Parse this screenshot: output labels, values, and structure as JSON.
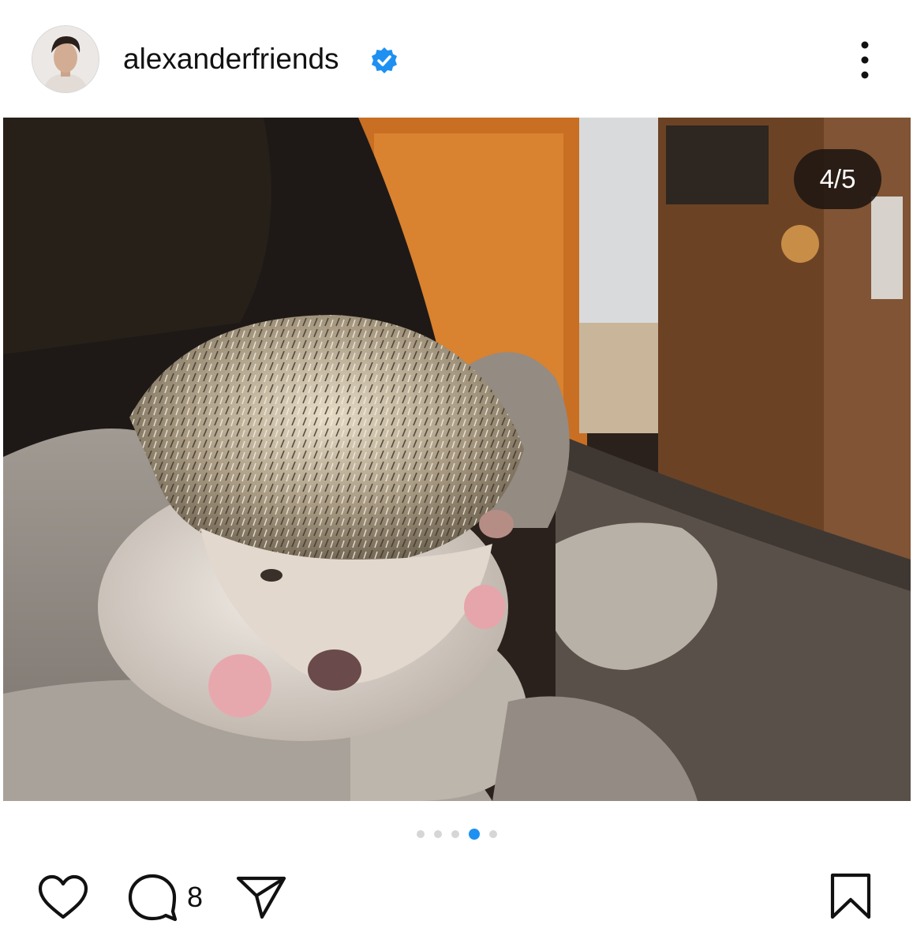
{
  "post": {
    "username": "alexanderfriends",
    "media_counter": "4/5",
    "carousel": {
      "total": 5,
      "active_index": 3
    },
    "comment_count": "8"
  },
  "icons": {
    "verified": "verified-badge-icon",
    "more": "more-vertical-icon",
    "like": "heart-icon",
    "comment": "comment-icon",
    "share": "send-icon",
    "save": "bookmark-icon"
  },
  "colors": {
    "verified_badge": "#1e90f2",
    "active_dot": "#1e90f2",
    "inactive_dot": "#d6d6d6"
  }
}
